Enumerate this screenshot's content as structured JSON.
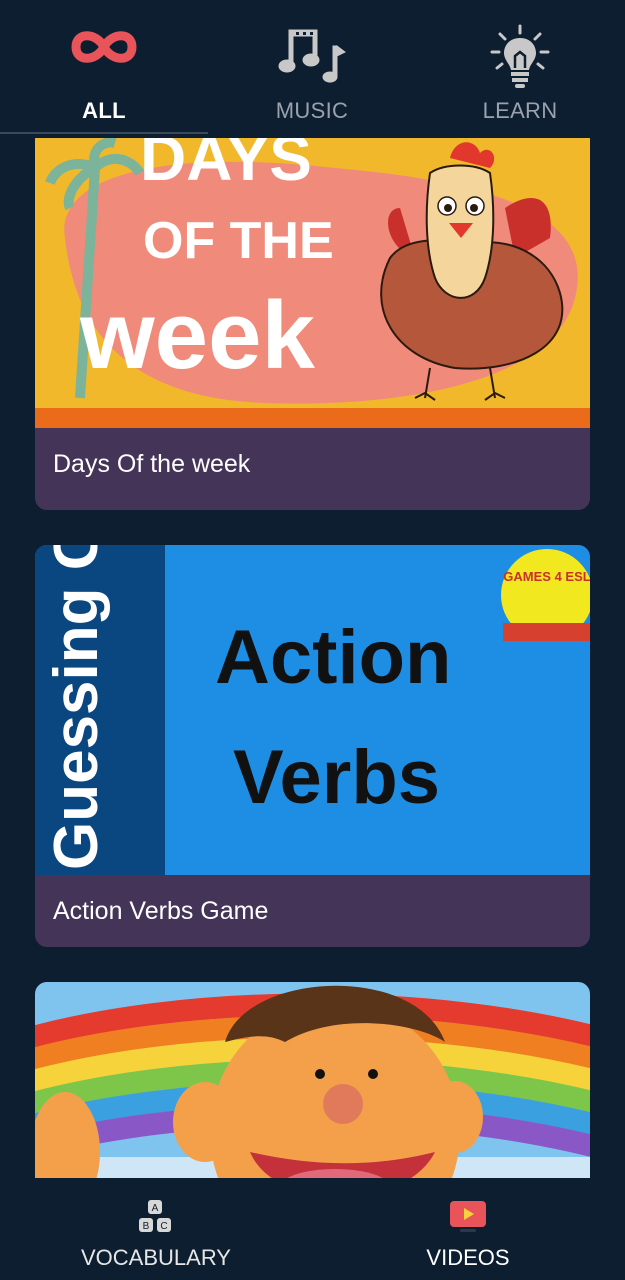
{
  "top_tabs": [
    {
      "label": "ALL",
      "icon": "infinity-icon",
      "active": true
    },
    {
      "label": "MUSIC",
      "icon": "music-notes-icon",
      "active": false
    },
    {
      "label": "LEARN",
      "icon": "lightbulb-icon",
      "active": false
    }
  ],
  "cards": [
    {
      "title": "Days Of the week",
      "thumb_text": {
        "line1": "DAYS",
        "line2": "OF THE",
        "line3": "week"
      }
    },
    {
      "title": "Action Verbs Game",
      "thumb_text": {
        "side": "Guessing Game",
        "line1": "Action",
        "line2": "Verbs",
        "badge": "GAMES 4 ESL"
      }
    },
    {
      "title": ""
    }
  ],
  "bottom_tabs": [
    {
      "label": "VOCABULARY",
      "icon": "abc-blocks-icon",
      "active": false
    },
    {
      "label": "VIDEOS",
      "icon": "play-video-icon",
      "active": true
    }
  ],
  "colors": {
    "background": "#0d1e30",
    "card_caption_bg": "#443558",
    "infinity_red": "#e8545a",
    "video_icon": "#e8545a"
  }
}
